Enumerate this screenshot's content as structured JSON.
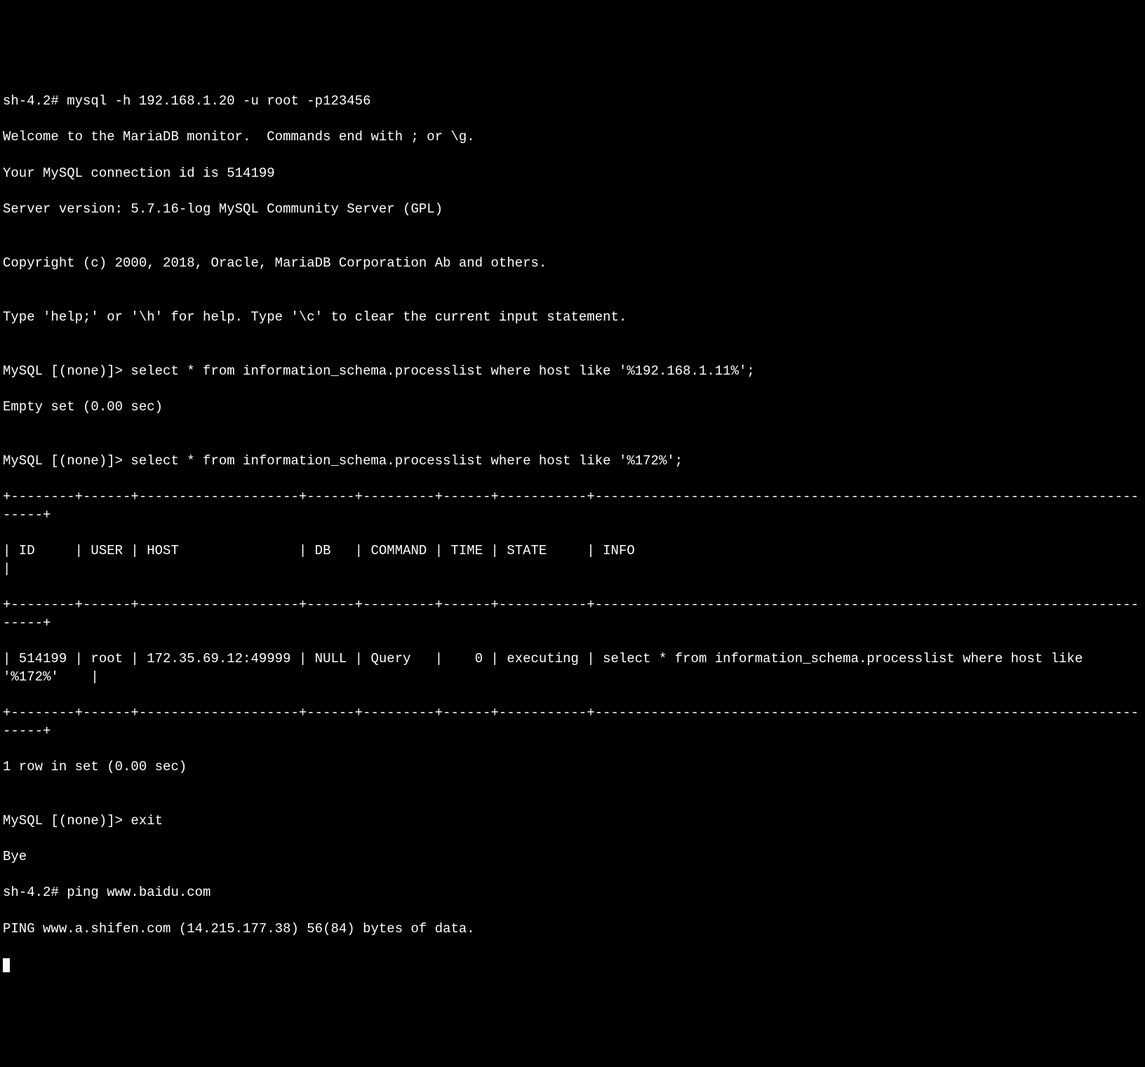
{
  "lines": [
    "sh-4.2# mysql -h 192.168.1.20 -u root -p123456",
    "Welcome to the MariaDB monitor.  Commands end with ; or \\g.",
    "Your MySQL connection id is 514199",
    "Server version: 5.7.16-log MySQL Community Server (GPL)",
    "",
    "Copyright (c) 2000, 2018, Oracle, MariaDB Corporation Ab and others.",
    "",
    "Type 'help;' or '\\h' for help. Type '\\c' to clear the current input statement.",
    "",
    "MySQL [(none)]> select * from information_schema.processlist where host like '%192.168.1.11%';",
    "Empty set (0.00 sec)",
    "",
    "MySQL [(none)]> select * from information_schema.processlist where host like '%172%';",
    "+--------+------+--------------------+------+---------+------+-----------+-------------------------------------------------------------------------+",
    "| ID     | USER | HOST               | DB   | COMMAND | TIME | STATE     | INFO                                                                    |",
    "+--------+------+--------------------+------+---------+------+-----------+-------------------------------------------------------------------------+",
    "| 514199 | root | 172.35.69.12:49999 | NULL | Query   |    0 | executing | select * from information_schema.processlist where host like '%172%'    |",
    "+--------+------+--------------------+------+---------+------+-----------+-------------------------------------------------------------------------+",
    "1 row in set (0.00 sec)",
    "",
    "MySQL [(none)]> exit",
    "Bye",
    "sh-4.2# ping www.baidu.com",
    "PING www.a.shifen.com (14.215.177.38) 56(84) bytes of data."
  ],
  "shell_prompt": "sh-4.2#",
  "mysql_prompt": "MySQL [(none)]>",
  "commands": {
    "mysql_login": "mysql -h 192.168.1.20 -u root -p123456",
    "query1": "select * from information_schema.processlist where host like '%192.168.1.11%';",
    "query2": "select * from information_schema.processlist where host like '%172%';",
    "exit": "exit",
    "ping": "ping www.baidu.com"
  },
  "connection": {
    "id": "514199",
    "server_version": "5.7.16-log MySQL Community Server (GPL)",
    "copyright": "Copyright (c) 2000, 2018, Oracle, MariaDB Corporation Ab and others."
  },
  "query1_result": "Empty set (0.00 sec)",
  "query2_result": {
    "columns": [
      "ID",
      "USER",
      "HOST",
      "DB",
      "COMMAND",
      "TIME",
      "STATE",
      "INFO"
    ],
    "rows": [
      {
        "ID": "514199",
        "USER": "root",
        "HOST": "172.35.69.12:49999",
        "DB": "NULL",
        "COMMAND": "Query",
        "TIME": "0",
        "STATE": "executing",
        "INFO": "select * from information_schema.processlist where host like '%172%'"
      }
    ],
    "summary": "1 row in set (0.00 sec)"
  },
  "ping_result": {
    "host": "www.baidu.com",
    "resolved": "www.a.shifen.com",
    "ip": "14.215.177.38",
    "data": "56(84) bytes of data."
  }
}
